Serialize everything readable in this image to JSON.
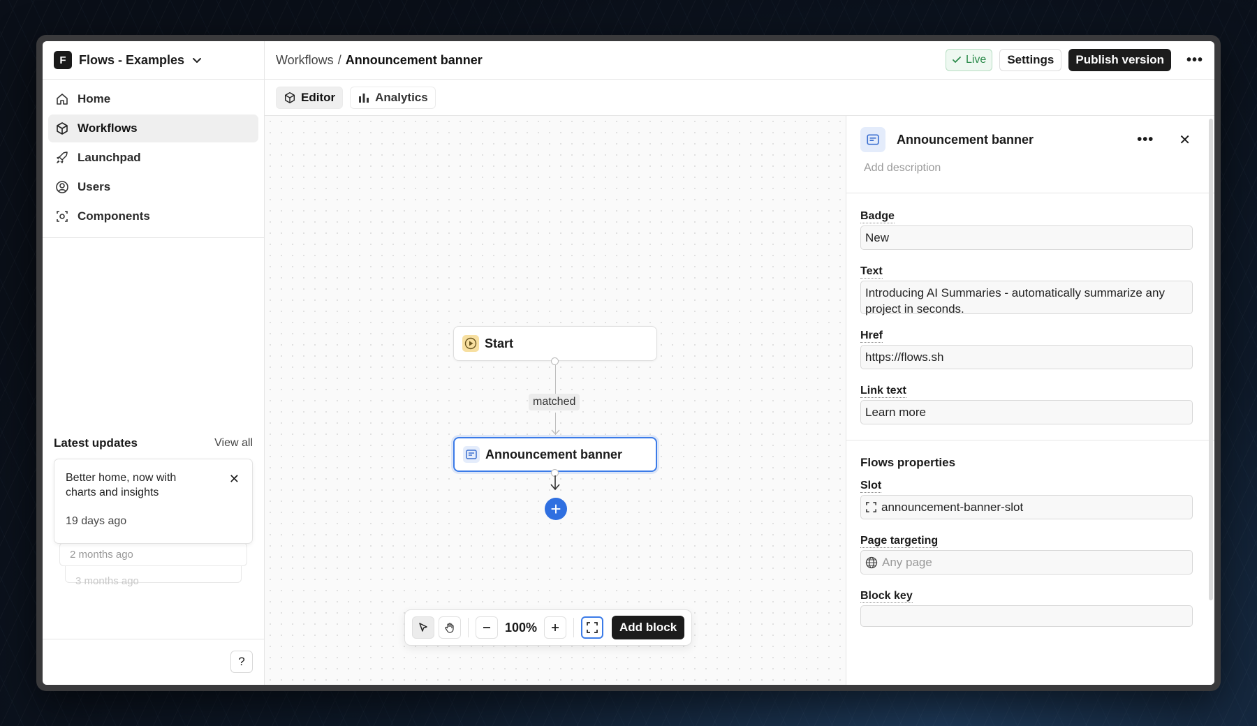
{
  "org": {
    "initial": "F",
    "name": "Flows - Examples"
  },
  "nav": [
    {
      "label": "Home",
      "icon": "home-icon"
    },
    {
      "label": "Workflows",
      "icon": "workflow-icon",
      "active": true
    },
    {
      "label": "Launchpad",
      "icon": "rocket-icon"
    },
    {
      "label": "Users",
      "icon": "user-circle-icon"
    },
    {
      "label": "Components",
      "icon": "components-icon"
    }
  ],
  "updates": {
    "title": "Latest updates",
    "view_all": "View all",
    "card": {
      "text": "Better home, now with charts and insights",
      "date": "19 days ago"
    },
    "stack1": "2 months ago",
    "stack2": "3 months ago"
  },
  "help_label": "?",
  "breadcrumb": {
    "parent": "Workflows",
    "separator": "/",
    "current": "Announcement banner"
  },
  "top_actions": {
    "live": "Live",
    "settings": "Settings",
    "publish": "Publish version"
  },
  "tabs": [
    {
      "label": "Editor",
      "active": true
    },
    {
      "label": "Analytics"
    }
  ],
  "canvas": {
    "start_label": "Start",
    "edge_label": "matched",
    "block_label": "Announcement banner"
  },
  "toolbar": {
    "zoom": "100%",
    "add_block": "Add block"
  },
  "panel": {
    "title": "Announcement banner",
    "description_placeholder": "Add description",
    "fields": {
      "badge": {
        "label": "Badge",
        "value": "New"
      },
      "text": {
        "label": "Text",
        "value": "Introducing AI Summaries - automatically summarize any project in seconds."
      },
      "href": {
        "label": "Href",
        "value": "https://flows.sh"
      },
      "link_text": {
        "label": "Link text",
        "value": "Learn more"
      }
    },
    "props_title": "Flows properties",
    "slot": {
      "label": "Slot",
      "value": "announcement-banner-slot"
    },
    "page_targeting": {
      "label": "Page targeting",
      "placeholder": "Any page"
    },
    "block_key": {
      "label": "Block key",
      "value": ""
    }
  },
  "colors": {
    "accent": "#2f6fe0",
    "live_green": "#2a8a4a",
    "dark": "#1c1c1c"
  }
}
